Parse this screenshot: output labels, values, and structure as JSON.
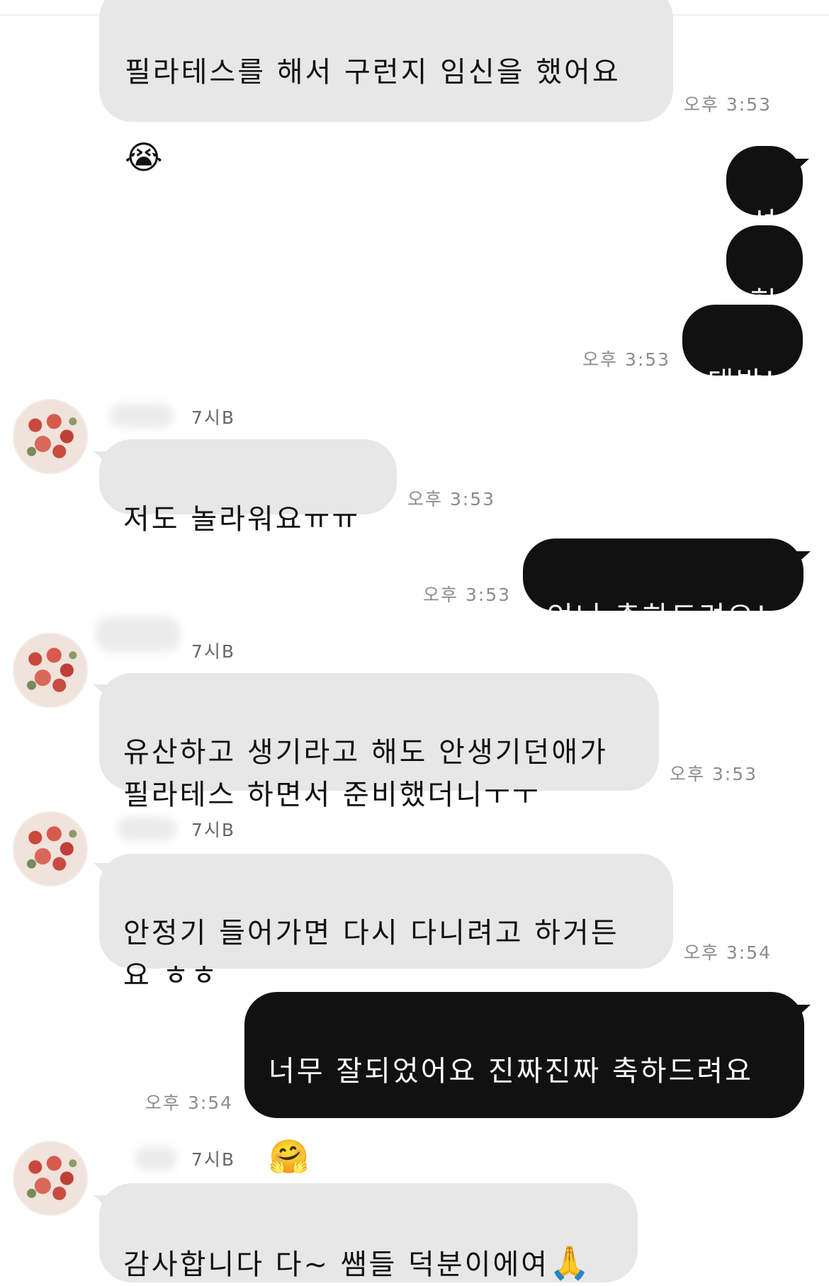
{
  "messages": [
    {
      "dir": "in",
      "text": "필라테스를 해서 구런지 임신을 했어요",
      "emoji": "😭",
      "time": "오후 3:53"
    },
    {
      "dir": "out",
      "text": "석"
    },
    {
      "dir": "out",
      "text": "헉"
    },
    {
      "dir": "out",
      "text": "대박!",
      "time": "오후 3:53"
    },
    {
      "dir": "in",
      "sender": "7시B",
      "text": "저도 놀라워요ㅠㅠ",
      "time": "오후 3:53"
    },
    {
      "dir": "out",
      "text": "언니 축하드려요!",
      "time": "오후 3:53"
    },
    {
      "dir": "in",
      "sender": "7시B",
      "text": "유산하고 생기라고 해도 안생기던애가\n필라테스 하면서 준비했더니ㅜㅜ",
      "time": "오후 3:53"
    },
    {
      "dir": "in",
      "sender": "7시B",
      "text": "안정기 들어가면 다시 다니려고 하거든\n요 ㅎㅎ",
      "time": "오후 3:54"
    },
    {
      "dir": "out",
      "text": "너무 잘되었어요 진짜진짜 축하드려요",
      "emoji": "🤗",
      "time": "오후 3:54"
    },
    {
      "dir": "in",
      "sender": "7시B",
      "text": "감사합니다 다~ 쌤들 덕분이에여",
      "emoji": "🙏"
    }
  ]
}
